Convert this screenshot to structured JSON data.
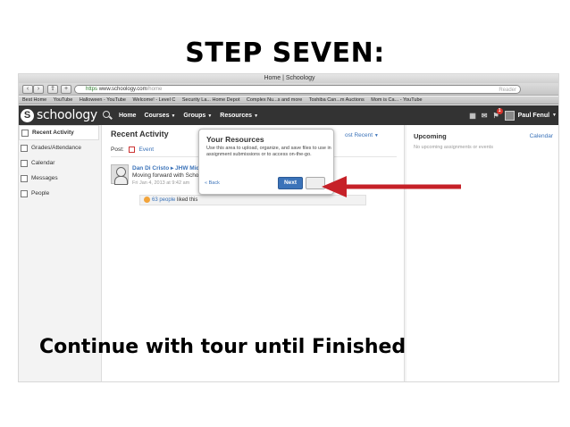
{
  "slide": {
    "title": "STEP SEVEN:",
    "caption": "Continue with tour until Finished"
  },
  "browser": {
    "window_title": "Home | Schoology",
    "url_scheme": "https",
    "url_host": "www.schoology.com",
    "url_path": "/home",
    "reader_label": "Reader",
    "bookmarks": [
      "Best Home",
      "YouTube",
      "Halloween - YouTube",
      "Welcome! - Level C",
      "Security La... Home Depot",
      "Complex Nu...s and more",
      "Toshiba Can...m Auctions",
      "Mom is Ca... - YouTube"
    ]
  },
  "appbar": {
    "logo_text": "schoology",
    "nav": [
      "Home",
      "Courses",
      "Groups",
      "Resources"
    ],
    "notification_count": "1",
    "user_name": "Paul Fenul"
  },
  "sidebar": {
    "items": [
      {
        "label": "Recent Activity",
        "icon": "activity-icon"
      },
      {
        "label": "Grades/Attendance",
        "icon": "grades-icon"
      },
      {
        "label": "Calendar",
        "icon": "calendar-icon"
      },
      {
        "label": "Messages",
        "icon": "messages-icon"
      },
      {
        "label": "People",
        "icon": "people-icon"
      }
    ]
  },
  "main": {
    "title": "Recent Activity",
    "most_recent": "ost Recent",
    "post_label": "Post:",
    "post_event": "Event",
    "post": {
      "author": "Dan Di Cristo ▸ JHW Midc",
      "text": "Moving forward with Schoo",
      "date": "Fri Jan 4, 2013 at 9:42 am",
      "likes_link": "63 people",
      "likes_rest": " liked this"
    }
  },
  "popover": {
    "title": "Your Resources",
    "body": "Use this area to upload, organize, and save files to use in assignment submissions or to access on-the-go.",
    "back": "« Back",
    "next": "Next"
  },
  "right": {
    "upcoming": "Upcoming",
    "calendar": "Calendar",
    "empty": "No upcoming assignments or events"
  },
  "colors": {
    "accent_blue": "#3b73b9",
    "appbar_dark": "#333333",
    "arrow_red": "#c62128"
  }
}
